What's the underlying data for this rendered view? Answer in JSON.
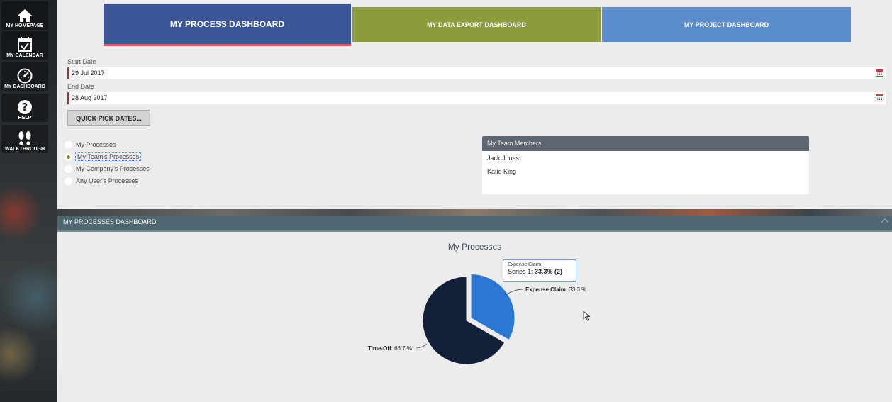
{
  "sidebar": {
    "items": [
      {
        "label": "MY HOMEPAGE",
        "icon": "home-icon"
      },
      {
        "label": "MY CALENDAR",
        "icon": "calendar-icon"
      },
      {
        "label": "MY DASHBOARD",
        "icon": "dashboard-gauge-icon"
      },
      {
        "label": "HELP",
        "icon": "help-icon"
      },
      {
        "label": "WALKTHROUGH",
        "icon": "footprints-icon"
      }
    ]
  },
  "tabs": [
    {
      "label": "MY PROCESS DASHBOARD",
      "color": "#3c5597",
      "active": true
    },
    {
      "label": "MY DATA EXPORT DASHBOARD",
      "color": "#8c9c3d"
    },
    {
      "label": "MY PROJECT DASHBOARD",
      "color": "#5b8ccc"
    }
  ],
  "filters": {
    "start_date_label": "Start Date",
    "start_date_value": "29 Jul 2017",
    "end_date_label": "End Date",
    "end_date_value": "28 Aug 2017",
    "quick_pick_label": "QUICK PICK DATES..."
  },
  "scope_options": [
    {
      "label": "My Processes",
      "selected": false
    },
    {
      "label": "My Team's Processes",
      "selected": true
    },
    {
      "label": "My Company's Processes",
      "selected": false
    },
    {
      "label": "Any User's Processes",
      "selected": false
    }
  ],
  "team_panel": {
    "title": "My Team Members",
    "members": [
      "Jack Jones",
      "Katie King"
    ]
  },
  "section": {
    "title": "MY PROCESSES DASHBOARD"
  },
  "chart_data": {
    "type": "pie",
    "title": "My Processes",
    "series": [
      {
        "name": "Series 1",
        "slices": [
          {
            "label": "Expense Claim",
            "value": 2,
            "percent": 33.3,
            "color": "#2b78d4",
            "exploded": true,
            "label_text": "33.3 %"
          },
          {
            "label": "Time-Off",
            "value": 4,
            "percent": 66.7,
            "color": "#122039",
            "exploded": false,
            "label_text": "66.7 %"
          }
        ]
      }
    ]
  },
  "tooltip": {
    "name": "Expense Claim",
    "series_prefix": "Series 1: ",
    "value_text": "33.3% (2)"
  }
}
